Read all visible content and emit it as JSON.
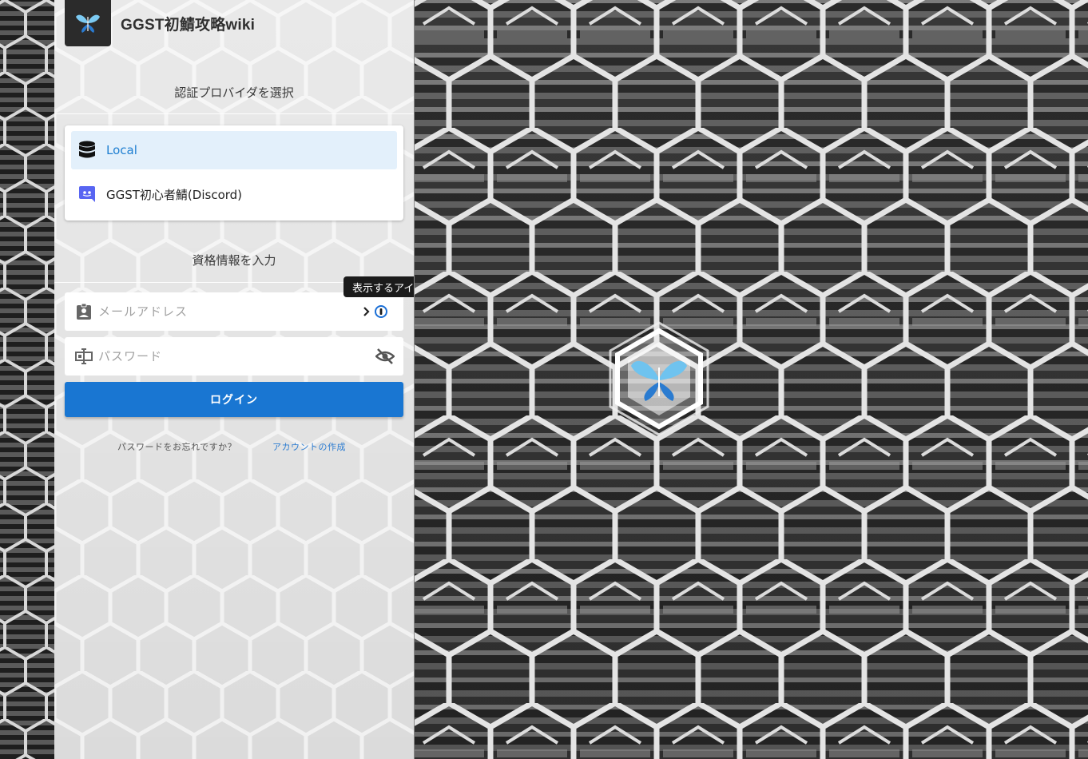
{
  "app": {
    "title": "GGST初鯖攻略wiki"
  },
  "provider_section": {
    "title": "認証プロバイダを選択",
    "providers": [
      {
        "label": "Local",
        "icon": "database-icon",
        "selected": true
      },
      {
        "label": "GGST初心者鯖(Discord)",
        "icon": "discord-icon",
        "selected": false
      }
    ]
  },
  "credentials_section": {
    "title": "資格情報を入力",
    "email_placeholder": "メールアドレス",
    "password_placeholder": "パスワード",
    "email_value": "",
    "password_value": ""
  },
  "tooltip": {
    "text": "表示するアイテムがありません"
  },
  "actions": {
    "login_label": "ログイン",
    "forgot_password": "パスワードをお忘れですか？",
    "create_account": "アカウントの作成"
  },
  "colors": {
    "accent": "#1976d2",
    "selected_bg": "#e3f0fb",
    "selected_text": "#1f7fd1",
    "link": "#2e7dd1",
    "discord": "#5865f2"
  }
}
